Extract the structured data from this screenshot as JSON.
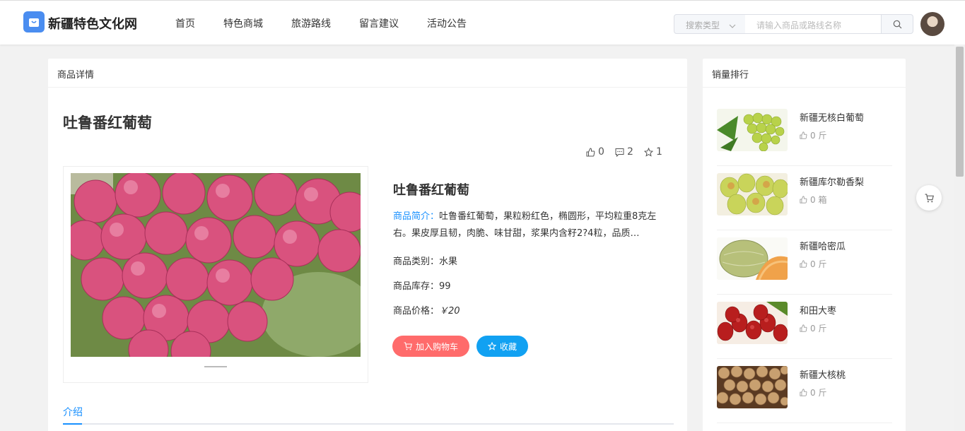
{
  "header": {
    "logo_text": "新疆特色文化网",
    "nav": [
      "首页",
      "特色商城",
      "旅游路线",
      "留言建议",
      "活动公告"
    ],
    "search_type": "搜索类型",
    "search_placeholder": "请输入商品或路线名称"
  },
  "detail": {
    "panel_title": "商品详情",
    "title": "吐鲁番红葡萄",
    "stats": {
      "likes": "0",
      "comments": "2",
      "favorites": "1"
    },
    "info_title": "吐鲁番红葡萄",
    "intro_label": "商品简介：",
    "intro_text": "吐鲁番红葡萄，果粒粉红色，椭圆形，平均粒重8克左右。果皮厚且韧，肉脆、味甘甜，浆果内含籽2?4粒，品质…",
    "category": "商品类别：水果",
    "stock": "商品库存：99",
    "price_label": "商品价格：",
    "price": "￥20",
    "add_cart": "加入购物车",
    "collect": "收藏",
    "tab": "介绍"
  },
  "ranking": {
    "panel_title": "销量排行",
    "items": [
      {
        "name": "新疆无核白葡萄",
        "sales": "0 斤"
      },
      {
        "name": "新疆库尔勒香梨",
        "sales": "0 箱"
      },
      {
        "name": "新疆哈密瓜",
        "sales": "0 斤"
      },
      {
        "name": "和田大枣",
        "sales": "0 斤"
      },
      {
        "name": "新疆大核桃",
        "sales": "0 斤"
      }
    ]
  },
  "colors": {
    "accent": "#1890ff",
    "cart_button": "#ff6b6b",
    "collect_button": "#11a1f2"
  }
}
